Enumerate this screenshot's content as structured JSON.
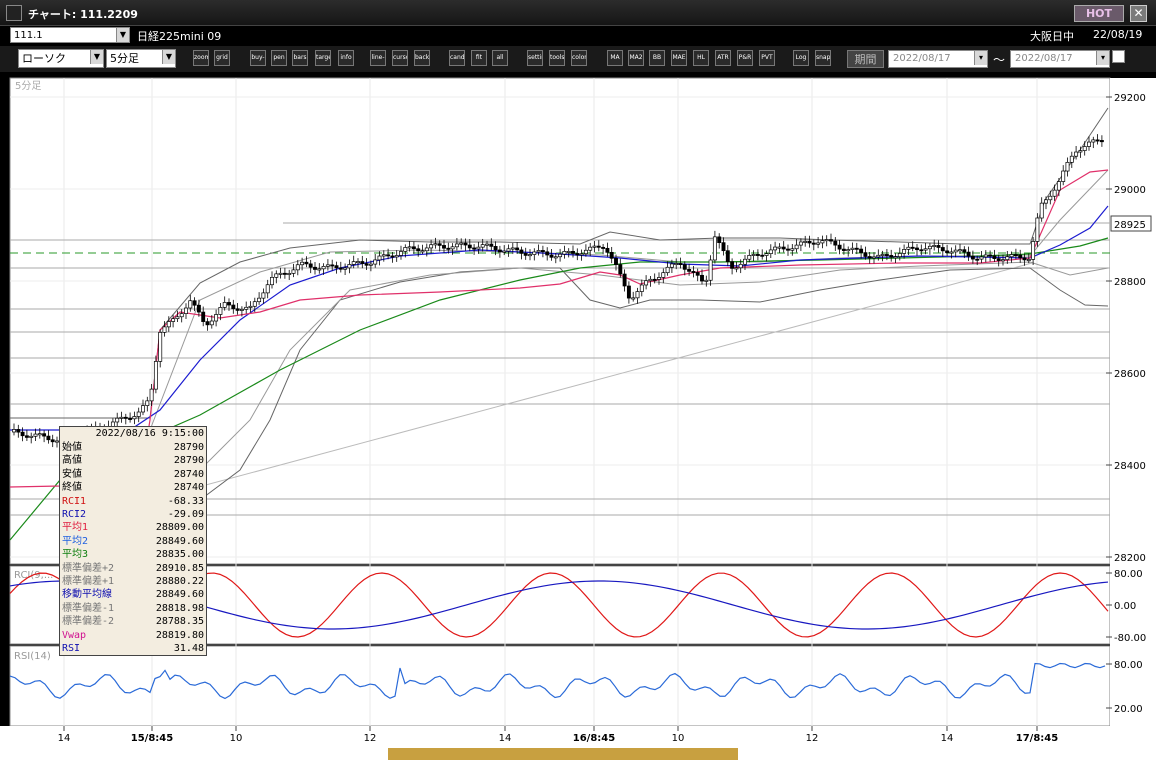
{
  "window": {
    "title": "チャート: 111.2209",
    "hot_label": "HOT",
    "close_label": "✕"
  },
  "header": {
    "symbol": "111.1",
    "instrument": "日経225mini 09",
    "session": "大阪日中",
    "date": "22/08/19"
  },
  "toolbar": {
    "chart_type": "ローソク",
    "timeframe": "5分足",
    "period_label": "期間",
    "date_from": "2022/08/17",
    "date_to": "2022/08/17",
    "tilde": "～",
    "buttons": [
      "zoom",
      "grid",
      "buy-sell",
      "pen",
      "bars",
      "target",
      "info",
      "line-draw",
      "cursor",
      "back",
      "candle",
      "fit",
      "all",
      "settings",
      "tools",
      "color",
      "MA",
      "MA2",
      "BB",
      "MAE",
      "HL",
      "ATR",
      "P&R",
      "PVT",
      "Log",
      "snapshot"
    ]
  },
  "panes": {
    "main_label": "5分足",
    "rci_label": "RCI(9,...",
    "rsi_label": "RSI(14)",
    "price_ticks": [
      "29200",
      "29000",
      "28800",
      "28600",
      "28400",
      "28200"
    ],
    "current_price": "28925",
    "rci_ticks": [
      "80.00",
      "0.00",
      "-80.00"
    ],
    "rsi_ticks": [
      "80.00",
      "20.00"
    ],
    "x_ticks": [
      "14",
      "15/8:45",
      "10",
      "12",
      "14",
      "16/8:45",
      "10",
      "12",
      "14",
      "17/8:45"
    ]
  },
  "colors": {
    "ma1": "#e0306a",
    "ma2": "#1c1cd0",
    "ma3": "#1a8a1a",
    "bb": "#9a9a9a",
    "rci1": "#e01818",
    "rci2": "#1818c0",
    "rsi": "#2a6ad8",
    "up": "#ffffff",
    "down": "#000000"
  },
  "info_box": {
    "date": "2022/08/16  9:15:00",
    "rows": [
      {
        "label": "始値",
        "value": "28790",
        "color": "#000"
      },
      {
        "label": "高値",
        "value": "28790",
        "color": "#000"
      },
      {
        "label": "安値",
        "value": "28740",
        "color": "#000"
      },
      {
        "label": "終値",
        "value": "28740",
        "color": "#000"
      },
      {
        "label": "RCI1",
        "value": "-68.33",
        "color": "#d01010"
      },
      {
        "label": "RCI2",
        "value": "-29.09",
        "color": "#1010b0"
      },
      {
        "label": "平均1",
        "value": "28809.00",
        "color": "#e02040"
      },
      {
        "label": "平均2",
        "value": "28849.60",
        "color": "#2060e0"
      },
      {
        "label": "平均3",
        "value": "28835.00",
        "color": "#108010"
      },
      {
        "label": "標準偏差+2",
        "value": "28910.85",
        "color": "#777"
      },
      {
        "label": "標準偏差+1",
        "value": "28880.22",
        "color": "#777"
      },
      {
        "label": "移動平均線",
        "value": "28849.60",
        "color": "#1010b0"
      },
      {
        "label": "標準偏差-1",
        "value": "28818.98",
        "color": "#777"
      },
      {
        "label": "標準偏差-2",
        "value": "28788.35",
        "color": "#777"
      },
      {
        "label": "Vwap",
        "value": "28819.80",
        "color": "#d01090"
      },
      {
        "label": "RSI",
        "value": "31.48",
        "color": "#1010b0"
      }
    ]
  }
}
